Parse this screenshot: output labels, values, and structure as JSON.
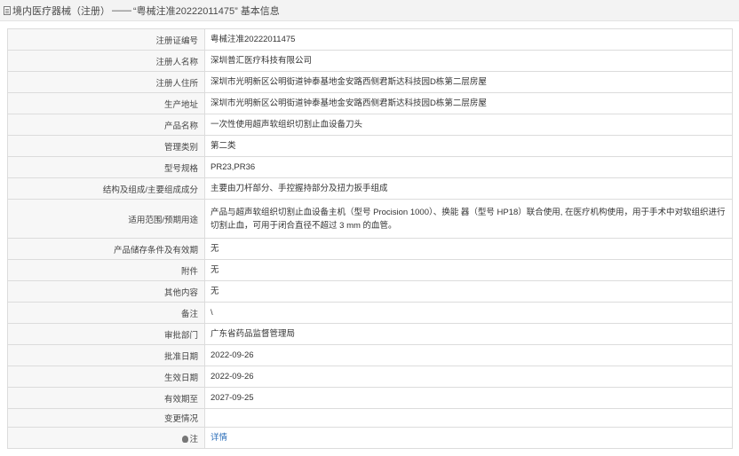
{
  "header": {
    "icon": "document-icon",
    "prefix": "境内医疗器械（注册）",
    "separator": "——",
    "registration_title": "“粤械注准20222011475”",
    "suffix": "基本信息"
  },
  "rows": [
    {
      "label": "注册证编号",
      "value": "粤械注准20222011475"
    },
    {
      "label": "注册人名称",
      "value": "深圳普汇医疗科技有限公司"
    },
    {
      "label": "注册人住所",
      "value": "深圳市光明新区公明街道钟泰基地金安路西侧君斯达科技园D栋第二层房屋"
    },
    {
      "label": "生产地址",
      "value": "深圳市光明新区公明街道钟泰基地金安路西侧君斯达科技园D栋第二层房屋"
    },
    {
      "label": "产品名称",
      "value": "一次性使用超声软组织切割止血设备刀头"
    },
    {
      "label": "管理类别",
      "value": "第二类"
    },
    {
      "label": "型号规格",
      "value": "PR23,PR36"
    },
    {
      "label": "结构及组成/主要组成成分",
      "value": "主要由刀杆部分、手控握持部分及扭力扳手组成"
    },
    {
      "label": "适用范围/预期用途",
      "value": "产品与超声软组织切割止血设备主机（型号 Procision 1000）、换能 器（型号 HP18）联合使用, 在医疗机构使用，用于手术中对软组织进行切割止血，可用于闭合直径不超过 3 mm 的血管。"
    },
    {
      "label": "产品储存条件及有效期",
      "value": "无"
    },
    {
      "label": "附件",
      "value": "无"
    },
    {
      "label": "其他内容",
      "value": "无"
    },
    {
      "label": "备注",
      "value": "\\"
    },
    {
      "label": "审批部门",
      "value": "广东省药品监督管理局"
    },
    {
      "label": "批准日期",
      "value": "2022-09-26"
    },
    {
      "label": "生效日期",
      "value": "2022-09-26"
    },
    {
      "label": "有效期至",
      "value": "2027-09-25"
    },
    {
      "label": "变更情况",
      "value": ""
    }
  ],
  "note_row": {
    "icon": "tip-icon",
    "label": "注",
    "link_text": "详情"
  }
}
